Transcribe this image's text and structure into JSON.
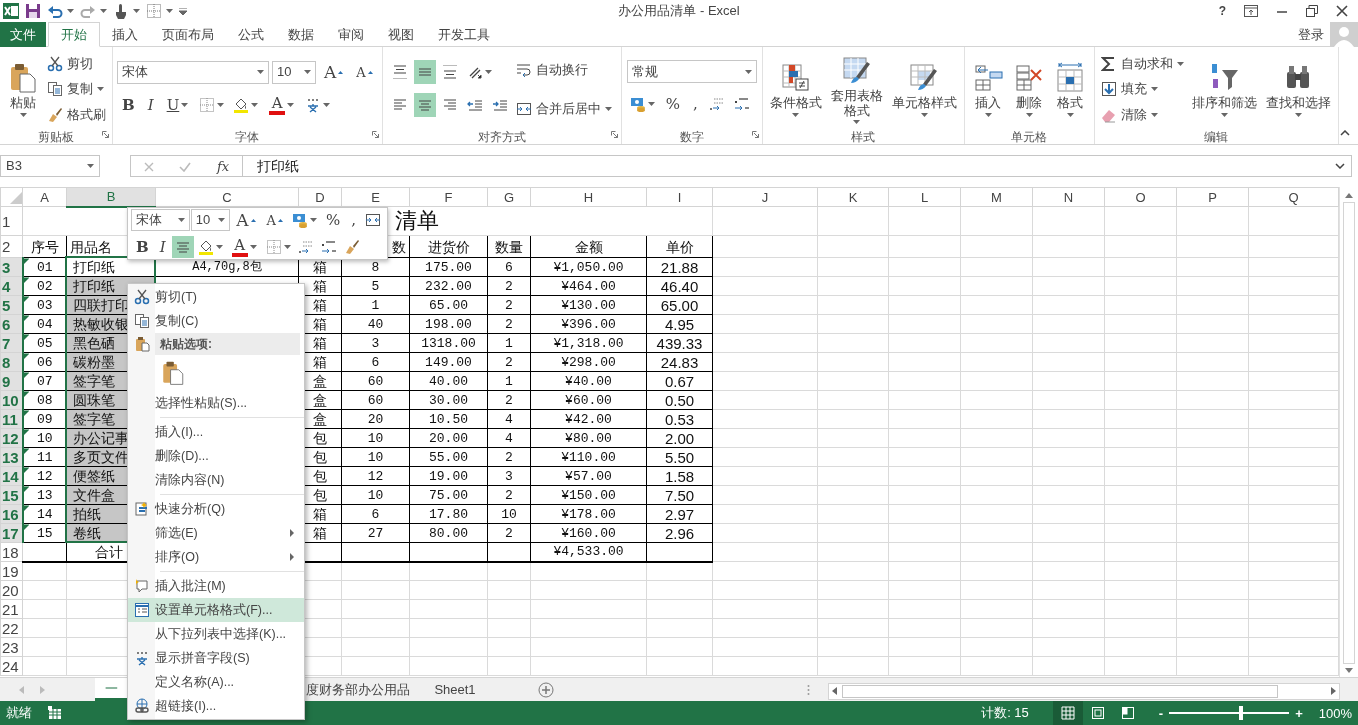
{
  "window": {
    "title": "办公用品清单 - Excel",
    "help": "?"
  },
  "ribbon_tabs": [
    {
      "label": "文件",
      "kind": "file",
      "selected": false
    },
    {
      "label": "开始",
      "kind": "tab",
      "selected": true
    },
    {
      "label": "插入",
      "kind": "tab",
      "selected": false
    },
    {
      "label": "页面布局",
      "kind": "tab",
      "selected": false
    },
    {
      "label": "公式",
      "kind": "tab",
      "selected": false
    },
    {
      "label": "数据",
      "kind": "tab",
      "selected": false
    },
    {
      "label": "审阅",
      "kind": "tab",
      "selected": false
    },
    {
      "label": "视图",
      "kind": "tab",
      "selected": false
    },
    {
      "label": "开发工具",
      "kind": "tab",
      "selected": false
    }
  ],
  "account": {
    "label": "登录"
  },
  "ribbon": {
    "groups": [
      {
        "label": "剪贴板",
        "launcher": true,
        "columns": [
          [
            {
              "kind": "large",
              "label": "粘贴",
              "dropdown": true
            }
          ],
          [
            {
              "kind": "small",
              "label": "剪切"
            },
            {
              "kind": "small",
              "label": "复制",
              "dropdown": true
            },
            {
              "kind": "small",
              "label": "格式刷"
            }
          ]
        ]
      },
      {
        "label": "字体",
        "launcher": true,
        "columns": [
          [
            {
              "kind": "row",
              "items": [
                {
                  "kind": "font-select",
                  "value": "宋体"
                },
                {
                  "kind": "size-select",
                  "value": "10"
                },
                {
                  "kind": "grow",
                  "label": "A"
                },
                {
                  "kind": "shrink",
                  "label": "A"
                }
              ]
            },
            {
              "kind": "row",
              "items": [
                {
                  "kind": "bold",
                  "label": "B"
                },
                {
                  "kind": "italic",
                  "label": "I"
                },
                {
                  "kind": "underline",
                  "label": "U",
                  "dropdown": true
                },
                {
                  "kind": "icon",
                  "dropdown": true
                },
                {
                  "kind": "icon",
                  "dropdown": true
                },
                {
                  "kind": "font-color",
                  "label": "A",
                  "dropdown": true
                },
                {
                  "kind": "icon",
                  "dropdown": true
                }
              ]
            }
          ]
        ]
      },
      {
        "label": "对齐方式",
        "launcher": true,
        "columns": [
          [
            {
              "kind": "row",
              "items": [
                {
                  "kind": "icon",
                  "selected": false
                },
                {
                  "kind": "icon",
                  "selected": true
                },
                {
                  "kind": "icon",
                  "selected": false
                },
                {
                  "kind": "icon",
                  "dropdown": true
                }
              ]
            },
            {
              "kind": "row",
              "items": [
                {
                  "kind": "icon",
                  "selected": false
                },
                {
                  "kind": "icon",
                  "selected": true
                },
                {
                  "kind": "icon",
                  "selected": false
                },
                {
                  "kind": "icon"
                },
                {
                  "kind": "icon"
                }
              ]
            }
          ],
          [
            {
              "kind": "small",
              "label": "自动换行"
            },
            {
              "kind": "small",
              "label": "合并后居中",
              "dropdown": true
            }
          ]
        ]
      },
      {
        "label": "数字",
        "launcher": true,
        "columns": [
          [
            {
              "kind": "row",
              "items": [
                {
                  "kind": "format-select",
                  "value": "常规"
                }
              ]
            },
            {
              "kind": "row",
              "items": [
                {
                  "kind": "icon",
                  "dropdown": true
                },
                {
                  "kind": "glyph",
                  "label": "%"
                },
                {
                  "kind": "glyph",
                  "label": ","
                },
                {
                  "kind": "icon"
                },
                {
                  "kind": "icon"
                }
              ]
            }
          ]
        ]
      },
      {
        "label": "样式",
        "columns": [
          [
            {
              "kind": "large",
              "label": "条件格式",
              "dropdown": true
            }
          ],
          [
            {
              "kind": "large",
              "label": "套用表格格式",
              "dropdown": true
            }
          ],
          [
            {
              "kind": "large",
              "label": "单元格样式",
              "dropdown": true
            }
          ]
        ]
      },
      {
        "label": "单元格",
        "columns": [
          [
            {
              "kind": "large",
              "label": "插入",
              "dropdown": true
            }
          ],
          [
            {
              "kind": "large",
              "label": "删除",
              "dropdown": true
            }
          ],
          [
            {
              "kind": "large",
              "label": "格式",
              "dropdown": true
            }
          ]
        ]
      },
      {
        "label": "编辑",
        "columns": [
          [
            {
              "kind": "small",
              "label": "自动求和",
              "dropdown": true
            },
            {
              "kind": "small",
              "label": "填充",
              "dropdown": true
            },
            {
              "kind": "small",
              "label": "清除",
              "dropdown": true
            }
          ],
          [
            {
              "kind": "large",
              "label": "排序和筛选",
              "dropdown": true
            }
          ],
          [
            {
              "kind": "large",
              "label": "查找和选择",
              "dropdown": true
            }
          ]
        ]
      }
    ]
  },
  "formula_bar": {
    "name_box": "B3",
    "function_label": "fx",
    "value": "打印纸"
  },
  "sheet": {
    "columns": [
      {
        "label": "A",
        "selected": false
      },
      {
        "label": "B",
        "selected": true
      },
      {
        "label": "C",
        "selected": false
      },
      {
        "label": "D",
        "selected": false
      },
      {
        "label": "E",
        "selected": false
      },
      {
        "label": "F",
        "selected": false
      },
      {
        "label": "G",
        "selected": false
      },
      {
        "label": "H",
        "selected": false
      },
      {
        "label": "I",
        "selected": false
      },
      {
        "label": "J",
        "selected": false
      },
      {
        "label": "K",
        "selected": false
      },
      {
        "label": "L",
        "selected": false
      },
      {
        "label": "M",
        "selected": false
      },
      {
        "label": "N",
        "selected": false
      },
      {
        "label": "O",
        "selected": false
      },
      {
        "label": "P",
        "selected": false
      },
      {
        "label": "Q",
        "selected": false
      }
    ],
    "rows": [
      {
        "label": "1",
        "kind": "title",
        "selected": false,
        "title": "清单"
      },
      {
        "label": "2",
        "kind": "header",
        "selected": false,
        "cells": [
          "序号",
          "用品名",
          null,
          null,
          "数",
          "进货价",
          "数量",
          "金额",
          "单价"
        ]
      },
      {
        "label": "3",
        "kind": "data",
        "selected": true,
        "active": true,
        "error_mark": true,
        "cells": [
          "01",
          "打印纸",
          "A4,70g,8包",
          "箱",
          "8",
          "175.00",
          "6",
          "¥1,050.00",
          "21.88"
        ]
      },
      {
        "label": "4",
        "kind": "data",
        "selected": true,
        "active": false,
        "error_mark": true,
        "cells": [
          "02",
          "打印纸",
          null,
          "箱",
          "5",
          "232.00",
          "2",
          "¥464.00",
          "46.40"
        ]
      },
      {
        "label": "5",
        "kind": "data",
        "selected": true,
        "active": false,
        "error_mark": true,
        "cells": [
          "03",
          "四联打印",
          null,
          "箱",
          "1",
          "65.00",
          "2",
          "¥130.00",
          "65.00"
        ]
      },
      {
        "label": "6",
        "kind": "data",
        "selected": true,
        "active": false,
        "error_mark": true,
        "cells": [
          "04",
          "热敏收银",
          null,
          "箱",
          "40",
          "198.00",
          "2",
          "¥396.00",
          "4.95"
        ]
      },
      {
        "label": "7",
        "kind": "data",
        "selected": true,
        "active": false,
        "error_mark": true,
        "cells": [
          "05",
          "黑色硒",
          null,
          "箱",
          "3",
          "1318.00",
          "1",
          "¥1,318.00",
          "439.33"
        ]
      },
      {
        "label": "8",
        "kind": "data",
        "selected": true,
        "active": false,
        "error_mark": true,
        "cells": [
          "06",
          "碳粉墨",
          null,
          "箱",
          "6",
          "149.00",
          "2",
          "¥298.00",
          "24.83"
        ]
      },
      {
        "label": "9",
        "kind": "data",
        "selected": true,
        "active": false,
        "error_mark": true,
        "cells": [
          "07",
          "签字笔",
          null,
          "盒",
          "60",
          "40.00",
          "1",
          "¥40.00",
          "0.67"
        ]
      },
      {
        "label": "10",
        "kind": "data",
        "selected": true,
        "active": false,
        "error_mark": true,
        "cells": [
          "08",
          "圆珠笔",
          null,
          "盒",
          "60",
          "30.00",
          "2",
          "¥60.00",
          "0.50"
        ]
      },
      {
        "label": "11",
        "kind": "data",
        "selected": true,
        "active": false,
        "error_mark": true,
        "cells": [
          "09",
          "签字笔",
          null,
          "盒",
          "20",
          "10.50",
          "4",
          "¥42.00",
          "0.53"
        ]
      },
      {
        "label": "12",
        "kind": "data",
        "selected": true,
        "active": false,
        "error_mark": true,
        "cells": [
          "10",
          "办公记事",
          null,
          "包",
          "10",
          "20.00",
          "4",
          "¥80.00",
          "2.00"
        ]
      },
      {
        "label": "13",
        "kind": "data",
        "selected": true,
        "active": false,
        "error_mark": true,
        "cells": [
          "11",
          "多页文件",
          null,
          "包",
          "10",
          "55.00",
          "2",
          "¥110.00",
          "5.50"
        ]
      },
      {
        "label": "14",
        "kind": "data",
        "selected": true,
        "active": false,
        "error_mark": true,
        "cells": [
          "12",
          "便签纸",
          null,
          "包",
          "12",
          "19.00",
          "3",
          "¥57.00",
          "1.58"
        ]
      },
      {
        "label": "15",
        "kind": "data",
        "selected": true,
        "active": false,
        "error_mark": true,
        "cells": [
          "13",
          "文件盒",
          null,
          "包",
          "10",
          "75.00",
          "2",
          "¥150.00",
          "7.50"
        ]
      },
      {
        "label": "16",
        "kind": "data",
        "selected": true,
        "active": false,
        "error_mark": true,
        "cells": [
          "14",
          "拍纸",
          null,
          "箱",
          "6",
          "17.80",
          "10",
          "¥178.00",
          "2.97"
        ]
      },
      {
        "label": "17",
        "kind": "data",
        "selected": true,
        "active": false,
        "error_mark": true,
        "cells": [
          "15",
          "卷纸",
          null,
          "箱",
          "27",
          "80.00",
          "2",
          "¥160.00",
          "2.96"
        ]
      },
      {
        "label": "18",
        "kind": "total",
        "selected": false,
        "cells": [
          null,
          "合计",
          null,
          null,
          null,
          null,
          null,
          "¥4,533.00",
          null
        ]
      },
      {
        "label": "19",
        "kind": "empty",
        "selected": false
      },
      {
        "label": "20",
        "kind": "empty",
        "selected": false
      },
      {
        "label": "21",
        "kind": "empty",
        "selected": false
      },
      {
        "label": "22",
        "kind": "empty",
        "selected": false
      },
      {
        "label": "23",
        "kind": "empty",
        "selected": false
      },
      {
        "label": "24",
        "kind": "empty",
        "selected": false
      }
    ]
  },
  "mini_toolbar": {
    "rows": [
      [
        {
          "kind": "font-select",
          "value": "宋体"
        },
        {
          "kind": "size-select",
          "value": "10"
        },
        {
          "kind": "grow",
          "label": "A"
        },
        {
          "kind": "shrink",
          "label": "A"
        },
        {
          "kind": "icon",
          "dropdown": true
        },
        {
          "kind": "glyph",
          "label": "%"
        },
        {
          "kind": "glyph",
          "label": ","
        },
        {
          "kind": "icon"
        }
      ],
      [
        {
          "kind": "bold",
          "label": "B"
        },
        {
          "kind": "italic",
          "label": "I"
        },
        {
          "kind": "icon",
          "selected": true
        },
        {
          "kind": "icon",
          "dropdown": true
        },
        {
          "kind": "font-color",
          "label": "A",
          "dropdown": true
        },
        {
          "kind": "icon",
          "dropdown": true
        },
        {
          "kind": "icon"
        },
        {
          "kind": "icon"
        },
        {
          "kind": "icon"
        }
      ]
    ]
  },
  "context_menu": {
    "items": [
      {
        "kind": "item",
        "label": "剪切(T)",
        "selected": false
      },
      {
        "kind": "item",
        "label": "复制(C)",
        "selected": false
      },
      {
        "kind": "header",
        "label": "粘贴选项:"
      },
      {
        "kind": "paste-options"
      },
      {
        "kind": "item",
        "label": "选择性粘贴(S)...",
        "selected": false
      },
      {
        "kind": "separator"
      },
      {
        "kind": "item",
        "label": "插入(I)...",
        "selected": false
      },
      {
        "kind": "item",
        "label": "删除(D)...",
        "selected": false
      },
      {
        "kind": "item",
        "label": "清除内容(N)",
        "selected": false
      },
      {
        "kind": "separator"
      },
      {
        "kind": "item",
        "label": "快速分析(Q)",
        "selected": false
      },
      {
        "kind": "item",
        "label": "筛选(E)",
        "selected": false,
        "submenu": true
      },
      {
        "kind": "item",
        "label": "排序(O)",
        "selected": false,
        "submenu": true
      },
      {
        "kind": "separator"
      },
      {
        "kind": "item",
        "label": "插入批注(M)",
        "selected": false
      },
      {
        "kind": "item",
        "label": "设置单元格格式(F)...",
        "selected": true
      },
      {
        "kind": "item",
        "label": "从下拉列表中选择(K)...",
        "selected": false
      },
      {
        "kind": "item",
        "label": "显示拼音字段(S)",
        "selected": false
      },
      {
        "kind": "item",
        "label": "定义名称(A)...",
        "selected": false
      },
      {
        "kind": "item",
        "label": "超链接(I)...",
        "selected": false
      }
    ]
  },
  "sheet_tabs": [
    {
      "label": "一",
      "selected": true
    },
    {
      "label": "度财务部办公用品",
      "selected": false
    },
    {
      "label": "Sheet1",
      "selected": false
    }
  ],
  "status_bar": {
    "state": "就绪",
    "count": "计数: 15",
    "views": [
      {
        "selected": true
      },
      {
        "selected": false
      },
      {
        "selected": false
      }
    ],
    "zoom": {
      "minus": "-",
      "plus": "+",
      "level": 0.6,
      "label": "100%"
    }
  }
}
